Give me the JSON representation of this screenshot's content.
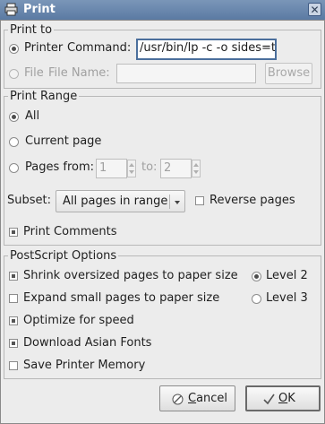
{
  "window": {
    "title": "Print"
  },
  "print_to": {
    "title": "Print to",
    "printer_label": "Printer",
    "command_label": "Command:",
    "command_value": "/usr/bin/lp -c  -o sides=t",
    "file_label": "File",
    "file_name_label": "File Name:",
    "file_name_value": "",
    "browse_label": "Browse"
  },
  "print_range": {
    "title": "Print Range",
    "all_label": "All",
    "current_page_label": "Current page",
    "pages_from_label": "Pages from:",
    "from_value": "1",
    "to_label": "to:",
    "to_value": "2",
    "subset_label": "Subset:",
    "subset_value": "All pages in range",
    "reverse_pages_label": "Reverse pages",
    "print_comments_label": "Print Comments"
  },
  "postscript": {
    "title": "PostScript Options",
    "shrink_label": "Shrink oversized pages to paper size",
    "expand_label": "Expand small pages to paper size",
    "optimize_label": "Optimize for speed",
    "asian_fonts_label": "Download Asian Fonts",
    "save_memory_label": "Save Printer Memory",
    "level2_label": "Level 2",
    "level3_label": "Level 3"
  },
  "buttons": {
    "cancel_label_pre": "",
    "cancel_mnemonic": "C",
    "cancel_label_post": "ancel",
    "ok_mnemonic": "O",
    "ok_label_post": "K"
  }
}
